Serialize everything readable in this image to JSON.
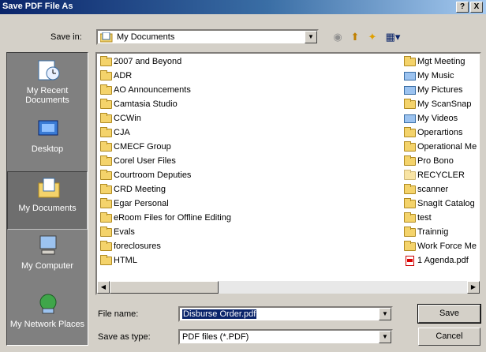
{
  "window": {
    "title": "Save PDF File As",
    "help_label": "?",
    "close_label": "X"
  },
  "toolbar": {
    "save_in_label": "Save in:",
    "location": "My Documents",
    "dropdown_arrow": "▼",
    "tools": [
      {
        "name": "back-icon",
        "glyph": "◉"
      },
      {
        "name": "up-folder-icon",
        "glyph": "⬆"
      },
      {
        "name": "new-folder-icon",
        "glyph": "✦"
      },
      {
        "name": "views-menu-icon",
        "glyph": "▦▾"
      }
    ]
  },
  "places": [
    {
      "label": "My Recent Documents",
      "icon": "recent-documents-icon"
    },
    {
      "label": "Desktop",
      "icon": "desktop-icon"
    },
    {
      "label": "My Documents",
      "icon": "my-documents-icon"
    },
    {
      "label": "My Computer",
      "icon": "my-computer-icon"
    },
    {
      "label": "My Network Places",
      "icon": "network-places-icon"
    }
  ],
  "files_left": [
    "2007 and Beyond",
    "ADR",
    "AO Announcements",
    "Camtasia Studio",
    "CCWin",
    "CJA",
    "CMECF Group",
    "Corel User Files",
    "Courtroom Deputies",
    "CRD Meeting",
    "Egar Personal",
    "eRoom Files for Offline Editing",
    "Evals",
    "foreclosures",
    "HTML"
  ],
  "files_right": [
    {
      "name": "Mgt Meeting",
      "type": "folder"
    },
    {
      "name": "My Music",
      "type": "special"
    },
    {
      "name": "My Pictures",
      "type": "special"
    },
    {
      "name": "My ScanSnap",
      "type": "folder"
    },
    {
      "name": "My Videos",
      "type": "special"
    },
    {
      "name": "Operartions",
      "type": "folder"
    },
    {
      "name": "Operational Me",
      "type": "folder"
    },
    {
      "name": "Pro Bono",
      "type": "folder"
    },
    {
      "name": "RECYCLER",
      "type": "folder"
    },
    {
      "name": "scanner",
      "type": "folder"
    },
    {
      "name": "SnagIt Catalog",
      "type": "folder"
    },
    {
      "name": "test",
      "type": "folder"
    },
    {
      "name": "Trainnig",
      "type": "folder"
    },
    {
      "name": "Work Force Me",
      "type": "folder"
    },
    {
      "name": "1 Agenda.pdf",
      "type": "pdf"
    }
  ],
  "scrollbar": {
    "left_arrow": "◀",
    "right_arrow": "▶"
  },
  "form": {
    "file_name_label": "File name:",
    "file_name_value": "Disburse Order.pdf",
    "save_type_label": "Save as type:",
    "save_type_value": "PDF files (*.PDF)",
    "dropdown_arrow": "▼"
  },
  "buttons": {
    "save": "Save",
    "cancel": "Cancel"
  }
}
